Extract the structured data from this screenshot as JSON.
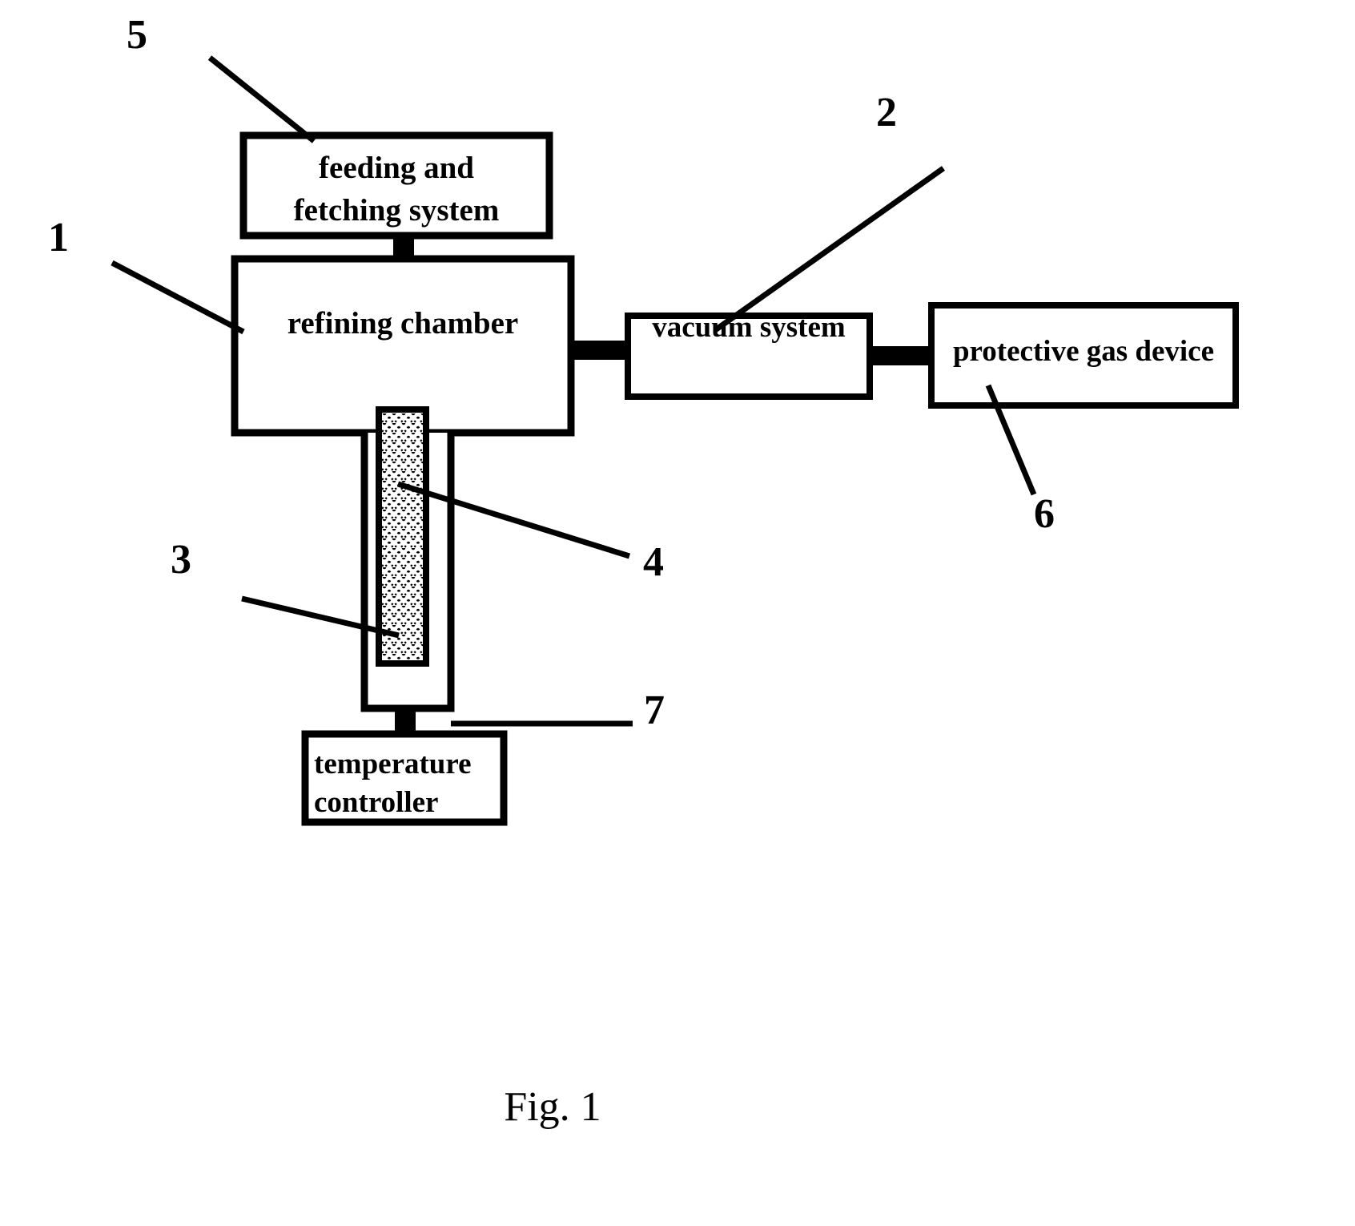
{
  "figure": {
    "caption": "Fig. 1",
    "background_color": "#ffffff",
    "line_color": "#000000"
  },
  "blocks": {
    "feeding_fetching": {
      "line1": "feeding and",
      "line2": "fetching system",
      "callout": "5"
    },
    "refining_chamber": {
      "label": "refining chamber",
      "callout": "1"
    },
    "vacuum_system": {
      "label": "vacuum system",
      "callout": "2"
    },
    "protective_gas_device": {
      "label": "protective gas device",
      "callout": "6"
    },
    "heating_furnace": {
      "label": "",
      "callout": "3"
    },
    "crucible": {
      "label": "",
      "callout": "4"
    },
    "temperature_controller": {
      "line1": "temperature",
      "line2": "controller",
      "callout": "7"
    }
  },
  "callout_numbers": {
    "n1": "1",
    "n2": "2",
    "n3": "3",
    "n4": "4",
    "n5": "5",
    "n6": "6",
    "n7": "7"
  }
}
